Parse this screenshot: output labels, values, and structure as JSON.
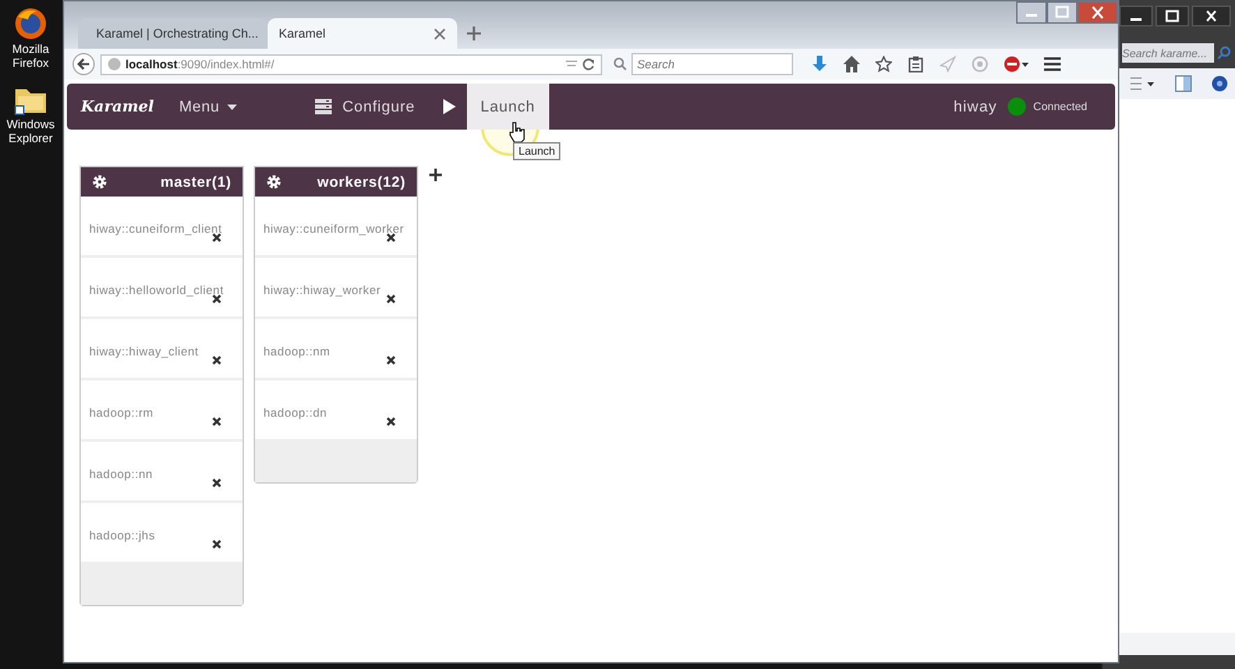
{
  "desktop_icons": [
    {
      "label": "Mozilla Firefox",
      "kind": "firefox"
    },
    {
      "label": "Windows Explorer",
      "kind": "explorer"
    }
  ],
  "explorer": {
    "search": {
      "placeholder": "Search karame..."
    }
  },
  "browser": {
    "tabs": [
      {
        "title": "Karamel | Orchestrating Ch...",
        "selected": false
      },
      {
        "title": "Karamel",
        "selected": true
      }
    ],
    "url": "**localhost**:9090/index.html#/",
    "search": {
      "placeholder": "Search"
    }
  },
  "app": {
    "logo": "Karamel",
    "menu": "Menu",
    "nav": [
      {
        "label": "Configure",
        "kind": "configure",
        "selected": false
      },
      {
        "label": "Launch",
        "kind": "launch",
        "selected": true
      }
    ],
    "user": "hiway",
    "status": {
      "label": "Connected",
      "connected": true
    },
    "tooltip": "Launch",
    "groups": [
      {
        "name": "master(1)",
        "recipes": [
          "hiway::cuneiform_client",
          "hiway::helloworld_client",
          "hiway::hiway_client",
          "hadoop::rm",
          "hadoop::nn",
          "hadoop::jhs"
        ]
      },
      {
        "name": "workers(12)",
        "recipes": [
          "hiway::cuneiform_worker",
          "hiway::hiway_worker",
          "hadoop::nm",
          "hadoop::dn"
        ]
      }
    ]
  }
}
